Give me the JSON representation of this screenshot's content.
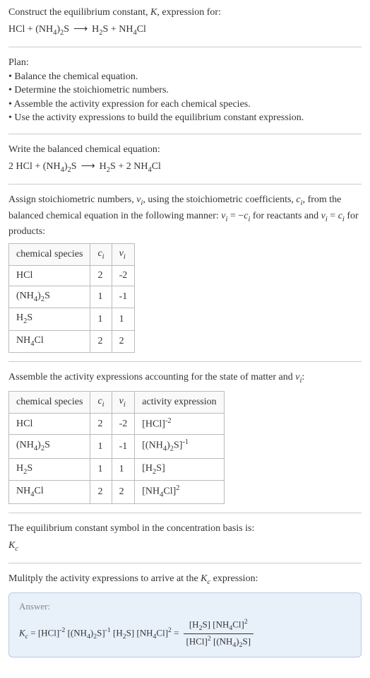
{
  "chart_data": [
    {
      "type": "table",
      "title": "Stoichiometric numbers",
      "headers": [
        "chemical species",
        "c_i",
        "ν_i"
      ],
      "rows": [
        [
          "HCl",
          "2",
          "-2"
        ],
        [
          "(NH4)2S",
          "1",
          "-1"
        ],
        [
          "H2S",
          "1",
          "1"
        ],
        [
          "NH4Cl",
          "2",
          "2"
        ]
      ]
    },
    {
      "type": "table",
      "title": "Activity expressions",
      "headers": [
        "chemical species",
        "c_i",
        "ν_i",
        "activity expression"
      ],
      "rows": [
        [
          "HCl",
          "2",
          "-2",
          "[HCl]^-2"
        ],
        [
          "(NH4)2S",
          "1",
          "-1",
          "[(NH4)2S]^-1"
        ],
        [
          "H2S",
          "1",
          "1",
          "[H2S]"
        ],
        [
          "NH4Cl",
          "2",
          "2",
          "[NH4Cl]^2"
        ]
      ]
    }
  ],
  "intro": {
    "line1": "Construct the equilibrium constant, ",
    "k": "K",
    "line1b": ", expression for:",
    "eq": "HCl + (NH4)2S ⟶ H2S + NH4Cl"
  },
  "plan": {
    "heading": "Plan:",
    "items": [
      "Balance the chemical equation.",
      "Determine the stoichiometric numbers.",
      "Assemble the activity expression for each chemical species.",
      "Use the activity expressions to build the equilibrium constant expression."
    ]
  },
  "balanced": {
    "heading": "Write the balanced chemical equation:",
    "eq": "2 HCl + (NH4)2S ⟶ H2S + 2 NH4Cl"
  },
  "assign": {
    "text1": "Assign stoichiometric numbers, ",
    "nu": "ν",
    "sub_i": "i",
    "text2": ", using the stoichiometric coefficients, ",
    "c": "c",
    "text3": ", from the balanced chemical equation in the following manner: ",
    "rel1a": "ν",
    "rel1b": " = −",
    "rel1c": "c",
    "text4": " for reactants and ",
    "rel2a": "ν",
    "rel2b": " = ",
    "rel2c": "c",
    "text5": " for products:"
  },
  "table1": {
    "h1": "chemical species",
    "h2_c": "c",
    "h2_i": "i",
    "h3_nu": "ν",
    "h3_i": "i",
    "r1": {
      "sp": "HCl",
      "c": "2",
      "nu": "-2"
    },
    "r2": {
      "sp_pre": "(NH",
      "sp_sub1": "4",
      "sp_mid": ")",
      "sp_sub2": "2",
      "sp_end": "S",
      "c": "1",
      "nu": "-1"
    },
    "r3": {
      "sp_pre": "H",
      "sp_sub": "2",
      "sp_end": "S",
      "c": "1",
      "nu": "1"
    },
    "r4": {
      "sp_pre": "NH",
      "sp_sub": "4",
      "sp_end": "Cl",
      "c": "2",
      "nu": "2"
    }
  },
  "assemble": {
    "text1": "Assemble the activity expressions accounting for the state of matter and ",
    "nu": "ν",
    "sub_i": "i",
    "text2": ":"
  },
  "table2": {
    "h1": "chemical species",
    "h2_c": "c",
    "h2_i": "i",
    "h3_nu": "ν",
    "h3_i": "i",
    "h4": "activity expression",
    "r1": {
      "sp": "HCl",
      "c": "2",
      "nu": "-2",
      "ae_pre": "[HCl]",
      "ae_sup": "-2"
    },
    "r2": {
      "sp_pre": "(NH",
      "sp_sub1": "4",
      "sp_mid": ")",
      "sp_sub2": "2",
      "sp_end": "S",
      "c": "1",
      "nu": "-1",
      "ae_pre": "[(NH",
      "ae_sub1": "4",
      "ae_mid": ")",
      "ae_sub2": "2",
      "ae_end": "S]",
      "ae_sup": "-1"
    },
    "r3": {
      "sp_pre": "H",
      "sp_sub": "2",
      "sp_end": "S",
      "c": "1",
      "nu": "1",
      "ae_pre": "[H",
      "ae_sub": "2",
      "ae_end": "S]"
    },
    "r4": {
      "sp_pre": "NH",
      "sp_sub": "4",
      "sp_end": "Cl",
      "c": "2",
      "nu": "2",
      "ae_pre": "[NH",
      "ae_sub": "4",
      "ae_end": "Cl]",
      "ae_sup": "2"
    }
  },
  "eqconst": {
    "text": "The equilibrium constant symbol in the concentration basis is:",
    "k": "K",
    "sub": "c"
  },
  "multiply": {
    "text1": "Mulitply the activity expressions to arrive at the ",
    "k": "K",
    "sub": "c",
    "text2": " expression:"
  },
  "answer": {
    "label": "Answer:",
    "k": "K",
    "sub": "c",
    "eq": " = ",
    "t1_pre": "[HCl]",
    "t1_sup": "-2",
    "t2_pre": " [(NH",
    "t2_sub1": "4",
    "t2_mid": ")",
    "t2_sub2": "2",
    "t2_end": "S]",
    "t2_sup": "-1",
    "t3_pre": " [H",
    "t3_sub": "2",
    "t3_end": "S]",
    "t4_pre": " [NH",
    "t4_sub": "4",
    "t4_end": "Cl]",
    "t4_sup": "2",
    "eq2": " = ",
    "num_t1_pre": "[H",
    "num_t1_sub": "2",
    "num_t1_end": "S]",
    "num_t2_pre": " [NH",
    "num_t2_sub": "4",
    "num_t2_end": "Cl]",
    "num_t2_sup": "2",
    "den_t1_pre": "[HCl]",
    "den_t1_sup": "2",
    "den_t2_pre": " [(NH",
    "den_t2_sub1": "4",
    "den_t2_mid": ")",
    "den_t2_sub2": "2",
    "den_t2_end": "S]"
  }
}
